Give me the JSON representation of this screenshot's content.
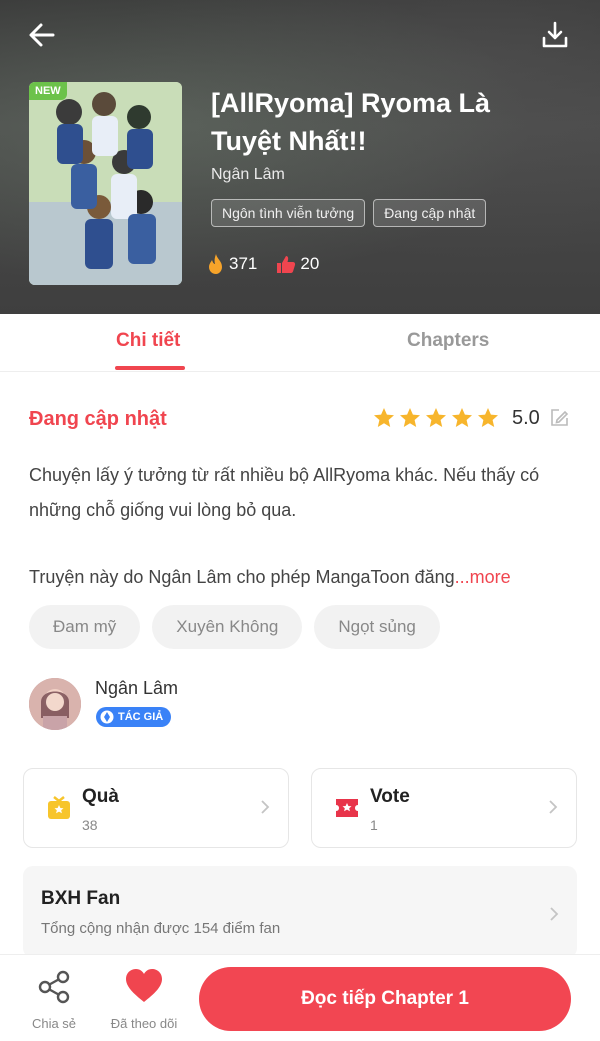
{
  "header": {
    "badge": "NEW",
    "title": "[AllRyoma] Ryoma Là Tuyệt Nhất!!",
    "author": "Ngân Lâm",
    "tags": [
      "Ngôn tình viễn tưởng",
      "Đang cập nhật"
    ],
    "fire_count": "371",
    "like_count": "20"
  },
  "tabs": [
    {
      "label": "Chi tiết",
      "active": true
    },
    {
      "label": "Chapters",
      "active": false
    }
  ],
  "details": {
    "status": "Đang cập nhật",
    "rating": "5.0",
    "stars": 5,
    "description_1": "Chuyện lấy ý tưởng từ rất nhiều bộ AllRyoma khác. Nếu thấy có những chỗ giống vui lòng bỏ qua.",
    "description_2": "Truyện này do Ngân Lâm cho phép MangaToon đăng",
    "more_label": "...more",
    "genres": [
      "Đam mỹ",
      "Xuyên Không",
      "Ngọt sủng"
    ]
  },
  "author_section": {
    "name": "Ngân Lâm",
    "badge": "TÁC GIẢ"
  },
  "cards": {
    "gift": {
      "title": "Quà",
      "count": "38"
    },
    "vote": {
      "title": "Vote",
      "count": "1"
    }
  },
  "fan_rank": {
    "title": "BXH Fan",
    "subtitle": "Tổng cộng nhận được 154 điểm fan"
  },
  "bottom_bar": {
    "share_label": "Chia sẻ",
    "follow_label": "Đã theo dõi",
    "read_label": "Đọc tiếp Chapter 1"
  },
  "colors": {
    "accent": "#f0454f",
    "star": "#f7b52c"
  }
}
